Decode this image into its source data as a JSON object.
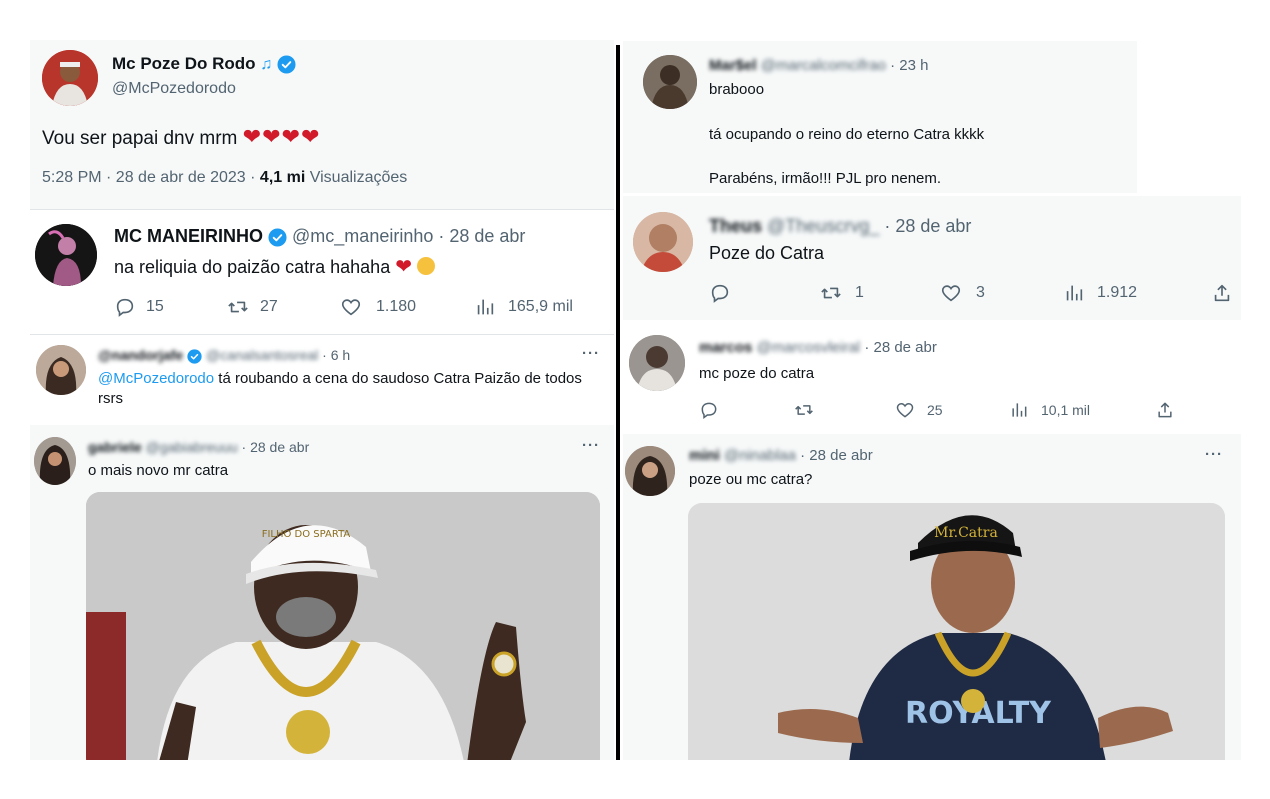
{
  "main_tweet": {
    "name": "Mc Poze Do Rodo",
    "handle": "@McPozedorodo",
    "text": "Vou ser papai dnv mrm",
    "hearts": "❤❤❤❤",
    "time": "5:28 PM · 28 de abr de 2023 ·",
    "views_count": "4,1 mi",
    "views_label": "Visualizações"
  },
  "reply_maneirinho": {
    "name": "MC MANEIRINHO",
    "handle": "@mc_maneirinho",
    "date": "· 28 de abr",
    "text": "na reliquia do paizão catra hahaha",
    "replies": "15",
    "retweets": "27",
    "likes": "1.180",
    "views": "165,9 mil"
  },
  "reply_nandor": {
    "name": "@nandorjafe",
    "handle": "@canalsantosreal",
    "date": "· 6 h",
    "mention": "@McPozedorodo",
    "text": " tá roubando a cena do saudoso Catra Paizão de todos rsrs"
  },
  "reply_gabriele": {
    "name": "gabriele",
    "handle": "@gabiabreuuu",
    "date": "· 28 de abr",
    "text": "o mais novo mr catra",
    "photo_cap_text": "FILHO DO SPARTA"
  },
  "reply_marbel": {
    "name": "Mar$el",
    "handle": "@marcalcomcifrao",
    "date": "· 23 h",
    "line1": "brabooo",
    "line2": "tá ocupando o reino do eterno Catra kkkk",
    "line3": "Parabéns, irmão!!! PJL pro nenem."
  },
  "reply_theus": {
    "name": "Theus",
    "handle": "@Theuscrvg_",
    "date": "· 28 de abr",
    "text": "Poze do Catra",
    "replies": "",
    "retweets": "1",
    "likes": "3",
    "views": "1.912"
  },
  "reply_marcos": {
    "name": "marcos",
    "handle": "@marcosvleiral",
    "date": "· 28 de abr",
    "text": "mc poze do catra",
    "likes": "25",
    "views": "10,1 mil"
  },
  "reply_mini": {
    "name": "mini",
    "handle": "@ninablaa",
    "date": "· 28 de abr",
    "text": "poze ou mc catra?",
    "photo_cap_text": "Mr.Catra",
    "photo_shirt_text": "ROYALTY"
  },
  "more_icon": "···",
  "colors": {
    "link": "#1d9bf0",
    "heart": "#d11a2a",
    "verified": "#1d9bf0",
    "text": "#0f1419",
    "muted": "#536471"
  }
}
